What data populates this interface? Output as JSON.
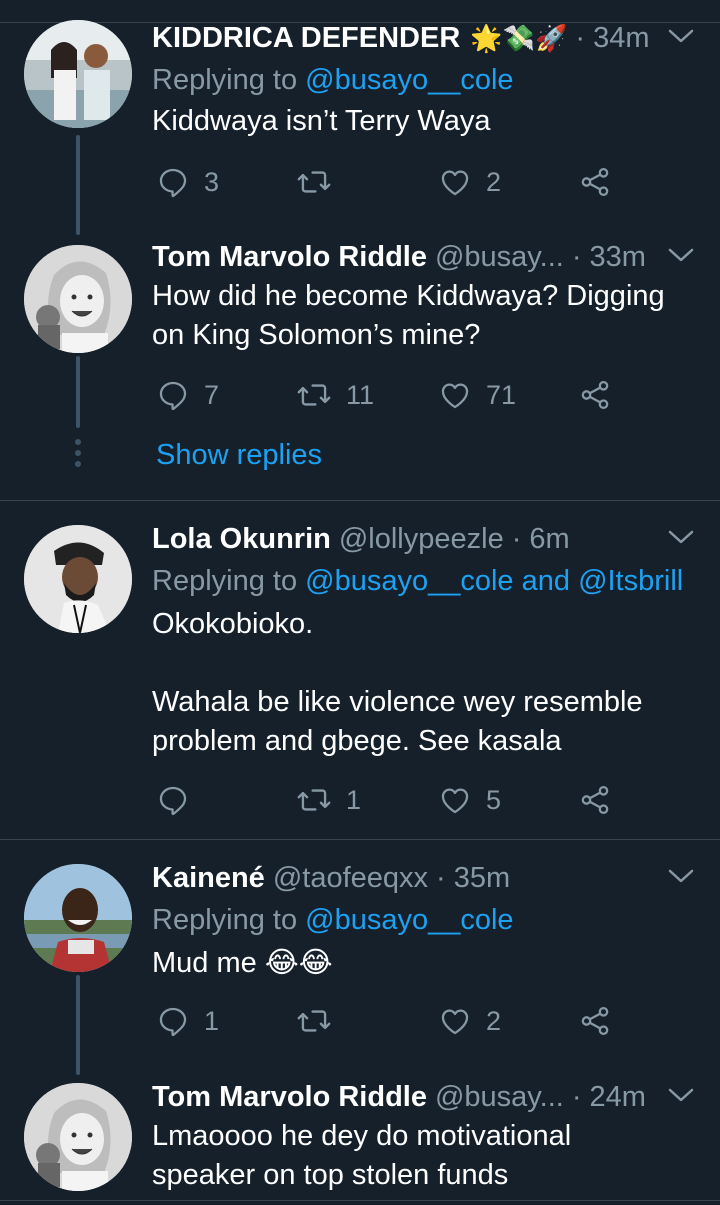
{
  "tweets": [
    {
      "name": "KIDDRICA DEFENDER",
      "name_emojis": "🌟💸🚀",
      "handle": "",
      "time": "· 34m",
      "replying_prefix": "Replying to ",
      "replying_to": "@busayo__cole",
      "body": [
        "Kiddwaya isn’t Terry Waya"
      ],
      "reply_count": "3",
      "retweet_count": "",
      "like_count": "2"
    },
    {
      "name": "Tom Marvolo Riddle",
      "handle": "@busay...",
      "time": "· 33m",
      "body": [
        "How did he become Kiddwaya? Digging",
        "on King Solomon’s mine?"
      ],
      "reply_count": "7",
      "retweet_count": "11",
      "like_count": "71",
      "show_replies": "Show replies"
    },
    {
      "name": "Lola Okunrin",
      "handle": "@lollypeezle",
      "time": "· 6m",
      "replying_prefix": "Replying to ",
      "replying_to": "@busayo__cole and @Itsbrill",
      "body": [
        "Okokobioko.",
        "",
        "Wahala be like violence wey resemble",
        "problem and gbege. See kasala"
      ],
      "reply_count": "",
      "retweet_count": "1",
      "like_count": "5"
    },
    {
      "name": "Kainené",
      "handle": "@taofeeqxx",
      "time": "· 35m",
      "replying_prefix": "Replying to ",
      "replying_to": "@busayo__cole",
      "body": [
        "Mud me 😂😂"
      ],
      "reply_count": "1",
      "retweet_count": "",
      "like_count": "2"
    },
    {
      "name": "Tom Marvolo Riddle",
      "handle": "@busay...",
      "time": "· 24m",
      "body": [
        "Lmaoooo he dey do motivational",
        "speaker on top stolen funds"
      ]
    }
  ],
  "icons": {
    "reply": "reply-icon",
    "retweet": "retweet-icon",
    "like": "heart-icon",
    "share": "share-icon",
    "more": "chevron-down-icon"
  },
  "colors": {
    "background": "#15202b",
    "text": "#ffffff",
    "secondary": "#8899a6",
    "link": "#1da1f2",
    "divider": "#38444d",
    "thread": "#3d5466"
  }
}
